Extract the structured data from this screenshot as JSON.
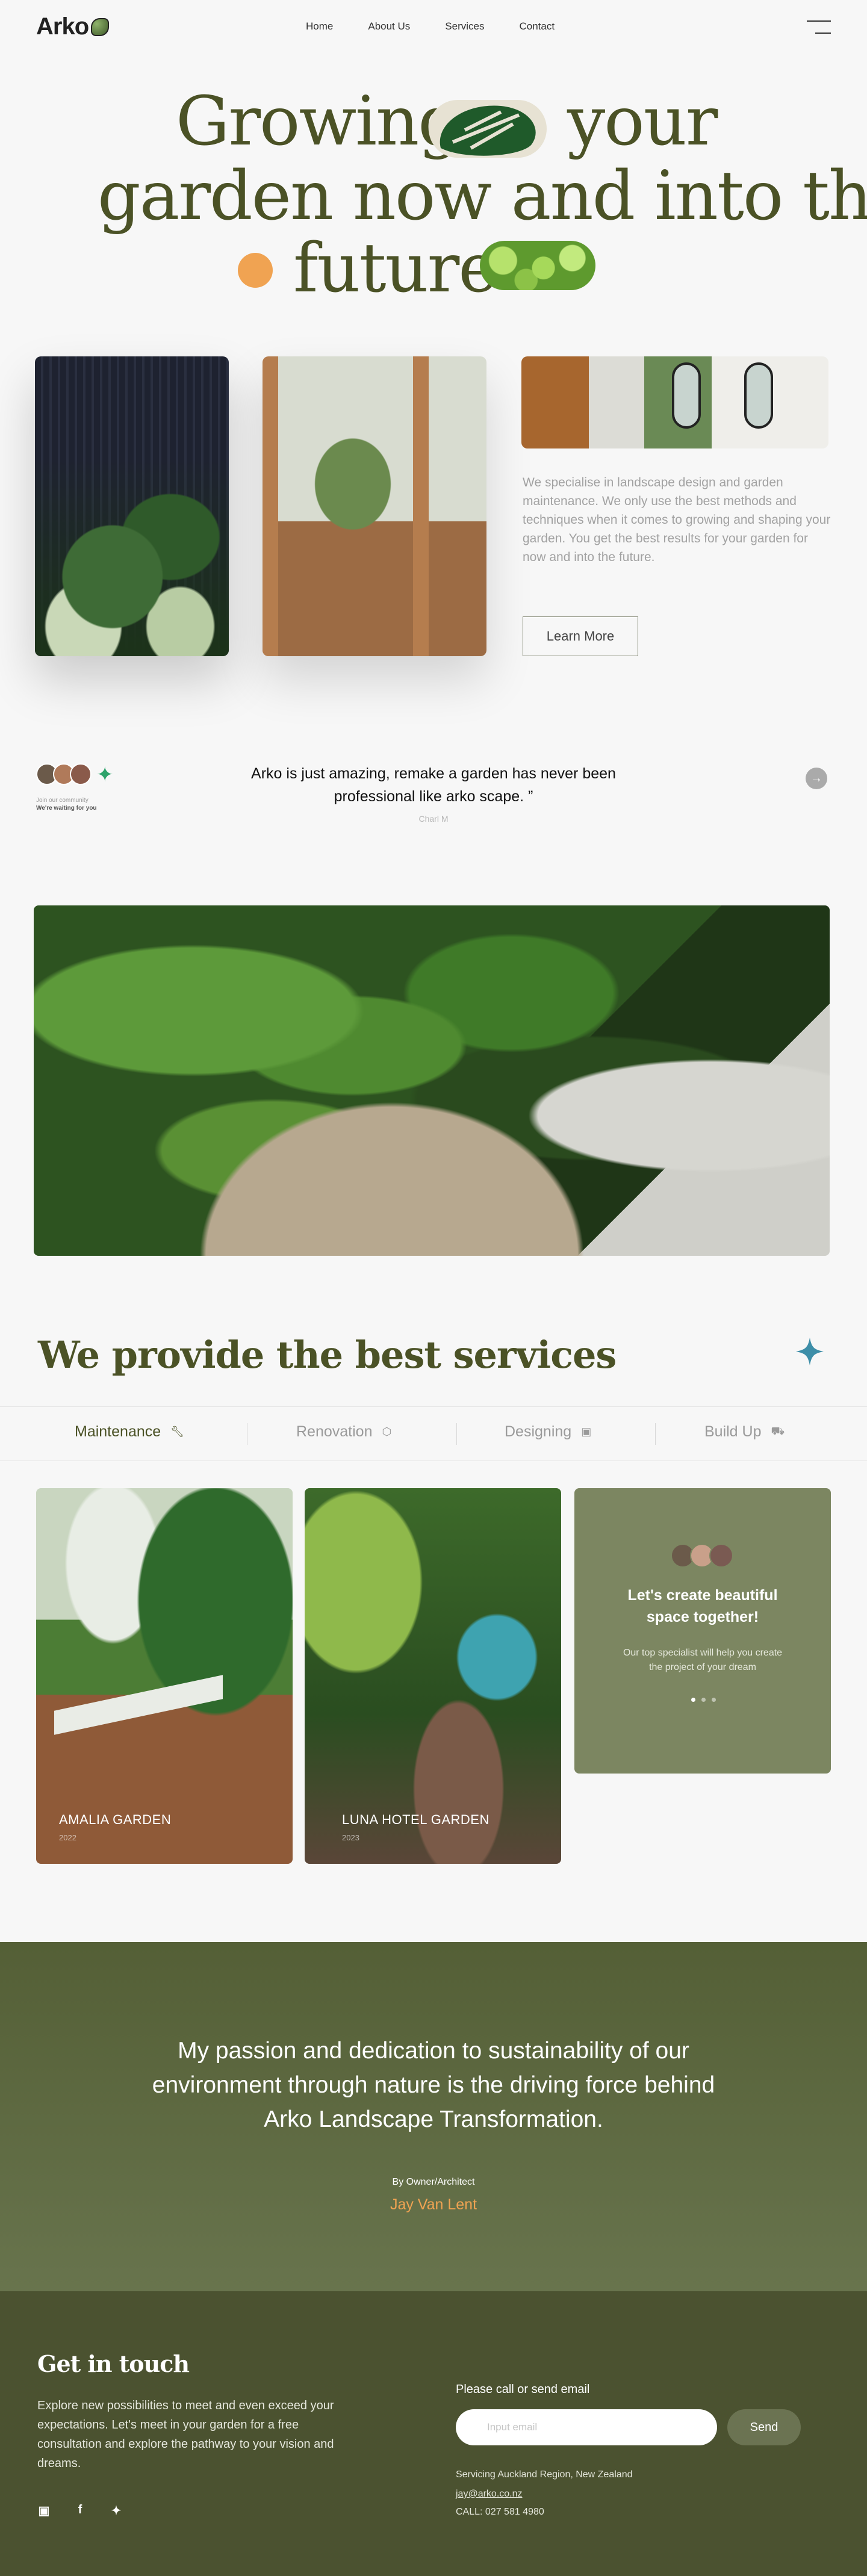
{
  "brand": {
    "logo": "Arko"
  },
  "nav": {
    "items": [
      "Home",
      "About Us",
      "Services",
      "Contact"
    ]
  },
  "hero": {
    "line1_a": "Growing",
    "line1_b": "your",
    "line2": "garden now and into the",
    "line3": "future"
  },
  "intro": {
    "description": "We specialise in landscape design and garden maintenance. We only use the best methods and techniques when it comes to growing and shaping your garden. You get the best results for your garden for now and into the future.",
    "button": "Learn More"
  },
  "testimonial": {
    "community_line1": "Join our community",
    "community_line2": "We're waiting for you",
    "quote": "Arko is just amazing, remake a garden has never been professional like arko scape. ”",
    "author": "Charl M"
  },
  "services": {
    "title": "We provide the best services",
    "tabs": [
      {
        "label": "Maintenance",
        "icon": "wrench-icon"
      },
      {
        "label": "Renovation",
        "icon": "box-icon"
      },
      {
        "label": "Designing",
        "icon": "image-icon"
      },
      {
        "label": "Build Up",
        "icon": "truck-icon"
      }
    ],
    "cards": [
      {
        "name": "AMALIA GARDEN",
        "year": "2022"
      },
      {
        "name": "LUNA HOTEL GARDEN",
        "year": "2023"
      }
    ],
    "cta": {
      "title": "Let's create beautiful space together!",
      "text": "Our top specialist will help you create the project of your dream",
      "active_slide": 1,
      "slides": 3
    }
  },
  "mission": {
    "text": "My passion and dedication to sustainability of our environment through nature is the driving force behind Arko Landscape Transformation.",
    "by": "By Owner/Architect",
    "name": "Jay Van Lent"
  },
  "footer": {
    "title": "Get in touch",
    "text": "Explore new possibilities to meet and even exceed your expectations. Let's meet in your garden for a free consultation and explore the pathway to your vision and dreams.",
    "call_label": "Please call or send email",
    "input_placeholder": "Input email",
    "send": "Send",
    "region": "Servicing Auckland Region, New Zealand",
    "email": "jay@arko.co.nz",
    "phone": "CALL: 027 581 4980",
    "socials": [
      {
        "name": "instagram-icon",
        "glyph": "▣"
      },
      {
        "name": "facebook-icon",
        "glyph": "f"
      },
      {
        "name": "twitter-icon",
        "glyph": "✦"
      }
    ]
  },
  "colors": {
    "olive_text": "#4b5226",
    "accent_orange": "#f0a352",
    "cta_card": "#7c8661",
    "footer_bg": "#4b5230",
    "sparkle_green": "#2ea36b",
    "star_teal": "#3d8ea8"
  }
}
